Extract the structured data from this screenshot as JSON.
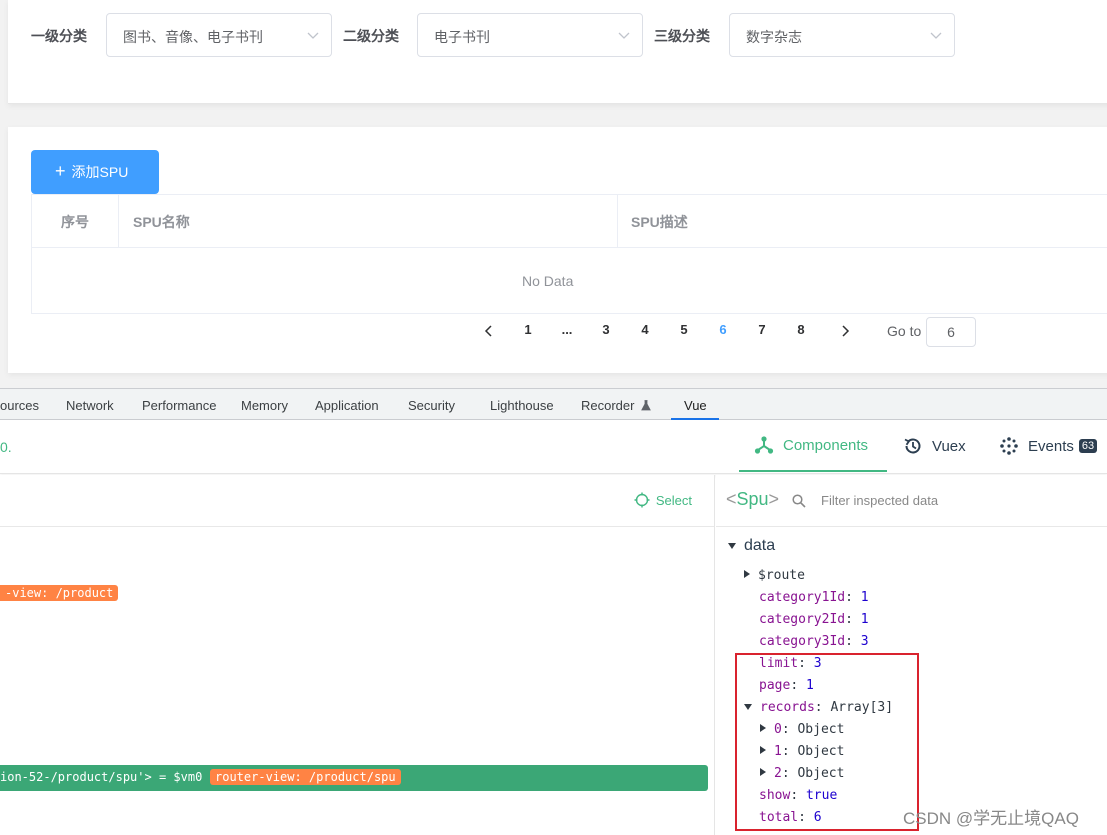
{
  "filters": {
    "level1_label": "一级分类",
    "level1_value": "图书、音像、电子书刊",
    "level2_label": "二级分类",
    "level2_value": "电子书刊",
    "level3_label": "三级分类",
    "level3_value": "数字杂志"
  },
  "spu": {
    "add_button": "添加SPU",
    "columns": [
      "序号",
      "SPU名称",
      "SPU描述"
    ],
    "empty_text": "No Data"
  },
  "pagination": {
    "pages": [
      "1",
      "...",
      "3",
      "4",
      "5",
      "6",
      "7",
      "8"
    ],
    "current": "6",
    "goto_label": "Go to",
    "goto_value": "6"
  },
  "devtools": {
    "tabs": [
      "ources",
      "Network",
      "Performance",
      "Memory",
      "Application",
      "Security",
      "Lighthouse",
      "Recorder",
      "Vue"
    ],
    "active_tab": "Vue"
  },
  "vue": {
    "version_text": "0.",
    "nav": [
      {
        "label": "Components",
        "icon": "components-icon"
      },
      {
        "label": "Vuex",
        "icon": "history-icon"
      },
      {
        "label": "Events",
        "icon": "events-icon",
        "badge": "63"
      }
    ],
    "select_label": "Select",
    "tree": {
      "router_view_1": "-view: /product",
      "component_row": "ion-52-/product/spu'> = $vm0",
      "router_view_2": "router-view: /product/spu"
    },
    "inspector": {
      "component": "Spu",
      "filter_placeholder": "Filter inspected data",
      "section": "data",
      "props": [
        {
          "key": "$route",
          "value": "",
          "expandable": true
        },
        {
          "key": "category1Id",
          "value": "1"
        },
        {
          "key": "category2Id",
          "value": "1"
        },
        {
          "key": "category3Id",
          "value": "3"
        },
        {
          "key": "limit",
          "value": "3"
        },
        {
          "key": "page",
          "value": "1"
        },
        {
          "key": "records",
          "value": "Array[3]",
          "expanded": true
        },
        {
          "key": "0",
          "value": "Object",
          "expandable": true,
          "child": true
        },
        {
          "key": "1",
          "value": "Object",
          "expandable": true,
          "child": true
        },
        {
          "key": "2",
          "value": "Object",
          "expandable": true,
          "child": true
        },
        {
          "key": "show",
          "value": "true"
        },
        {
          "key": "total",
          "value": "6"
        }
      ]
    }
  },
  "watermark": "CSDN @学无止境QAQ",
  "colors": {
    "primary": "#409eff",
    "vue_green": "#42b883",
    "highlight_red": "#d9232e",
    "orange_tag": "#ff8344"
  }
}
